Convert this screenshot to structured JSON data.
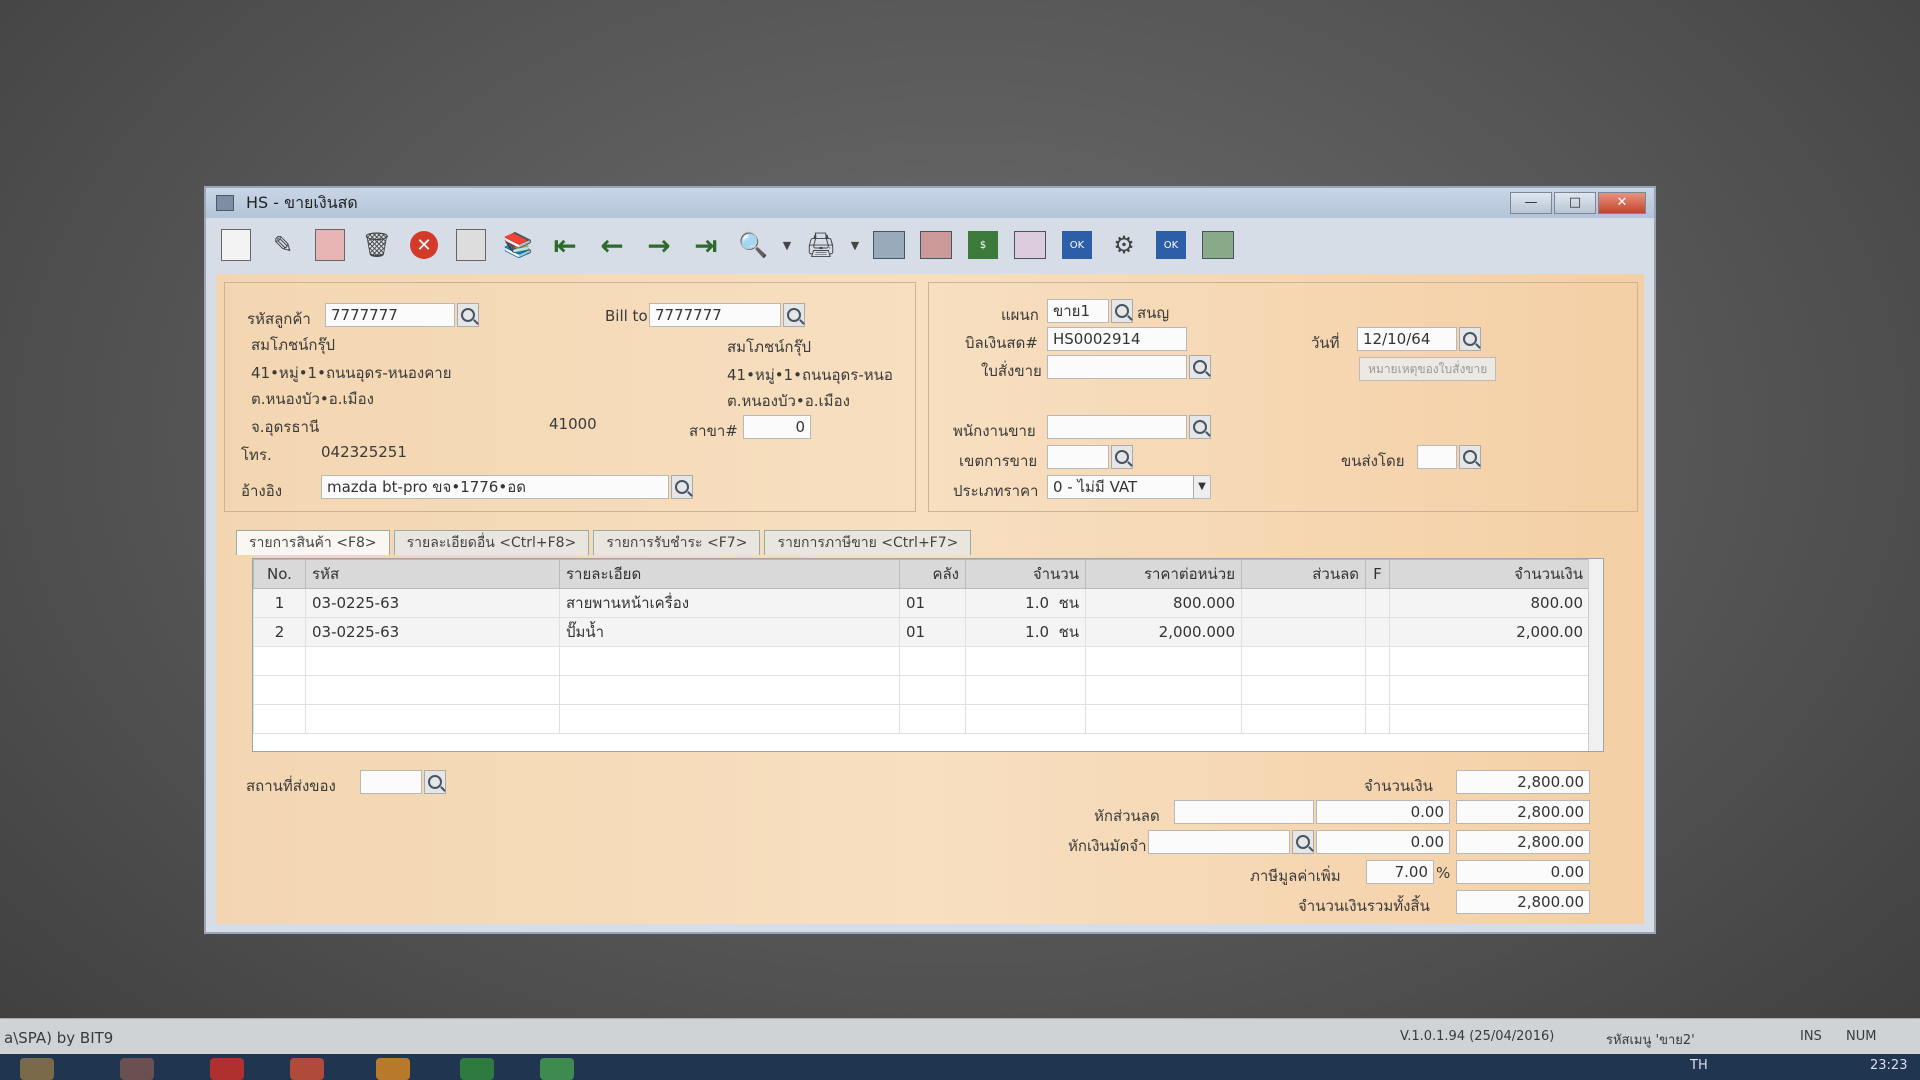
{
  "window": {
    "title": "HS - ขายเงินสด",
    "min": "—",
    "max": "□",
    "close": "✕"
  },
  "customer": {
    "code_label": "รหัสลูกค้า",
    "code": "7777777",
    "name": "สมโภชน์กรุ๊ป",
    "addr1": "41•หมู่•1•ถนนอุดร-หนองคาย",
    "addr2": "ต.หนองบัว•อ.เมือง",
    "addr3": "จ.อุดรธานี",
    "postcode": "41000",
    "phone_label": "โทร.",
    "phone": "042325251",
    "ref_label": "อ้างอิง",
    "ref": "mazda bt-pro ขจ•1776•อด"
  },
  "billto": {
    "label": "Bill to",
    "code": "7777777",
    "name": "สมโภชน์กรุ๊ป",
    "addr1": "41•หมู่•1•ถนนอุดร-หนอ",
    "addr2": "ต.หนองบัว•อ.เมือง",
    "branch_label": "สาขา#",
    "branch": "0"
  },
  "doc": {
    "dept_label": "แผนก",
    "dept": "ขาย1",
    "dept_name": "สนญ",
    "bill_label": "บิลเงินสด#",
    "bill_no": "HS0002914",
    "date_label": "วันที่",
    "date": "12/10/64",
    "so_label": "ใบสั่งขาย",
    "so_note": "หมายเหตุของใบสั่งขาย",
    "salesman_label": "พนักงานขาย",
    "area_label": "เขตการขาย",
    "ship_label": "ขนส่งโดย",
    "pricetype_label": "ประเภทราคา",
    "pricetype": "0 - ไม่มี VAT"
  },
  "tabs": [
    "รายการสินค้า <F8>",
    "รายละเอียดอื่น <Ctrl+F8>",
    "รายการรับชำระ <F7>",
    "รายการภาษีขาย <Ctrl+F7>"
  ],
  "grid": {
    "headers": [
      "No.",
      "รหัส",
      "รายละเอียด",
      "คลัง",
      "จำนวน",
      "ราคาต่อหน่วย",
      "ส่วนลด",
      "F",
      "จำนวนเงิน"
    ],
    "rows": [
      {
        "no": "1",
        "code": "03-0225-63",
        "desc": "สายพานหน้าเครื่อง",
        "wh": "01",
        "qty": "1.0",
        "unit": "ชน",
        "price": "800.000",
        "disc": "",
        "f": "",
        "amount": "800.00"
      },
      {
        "no": "2",
        "code": "03-0225-63",
        "desc": "ปั๊มน้ำ",
        "wh": "01",
        "qty": "1.0",
        "unit": "ชน",
        "price": "2,000.000",
        "disc": "",
        "f": "",
        "amount": "2,000.00"
      }
    ]
  },
  "footer": {
    "delivery_label": "สถานที่ส่งของ",
    "amount_label": "จำนวนเงิน",
    "amount": "2,800.00",
    "discount_label": "หักส่วนลด",
    "discount": "0.00",
    "after_discount": "2,800.00",
    "deposit_label": "หักเงินมัดจำ",
    "deposit": "0.00",
    "after_deposit": "2,800.00",
    "vat_label": "ภาษีมูลค่าเพิ่ม",
    "vat_rate": "7.00",
    "vat_pct": "%",
    "vat": "0.00",
    "total_label": "จำนวนเงินรวมทั้งสิ้น",
    "total": "2,800.00"
  },
  "status": {
    "left": "a\\SPA) by BIT9",
    "version": "V.1.0.1.94 (25/04/2016)",
    "user": "รหัสเมนู 'ขาย2'",
    "ins": "INS",
    "num": "NUM"
  },
  "taskbar": {
    "lang": "TH",
    "time": "23:23"
  },
  "colors": {
    "panel_bg": "#f6d9b6",
    "title_bg": "#c2d1e4",
    "close_red": "#c9472f"
  }
}
